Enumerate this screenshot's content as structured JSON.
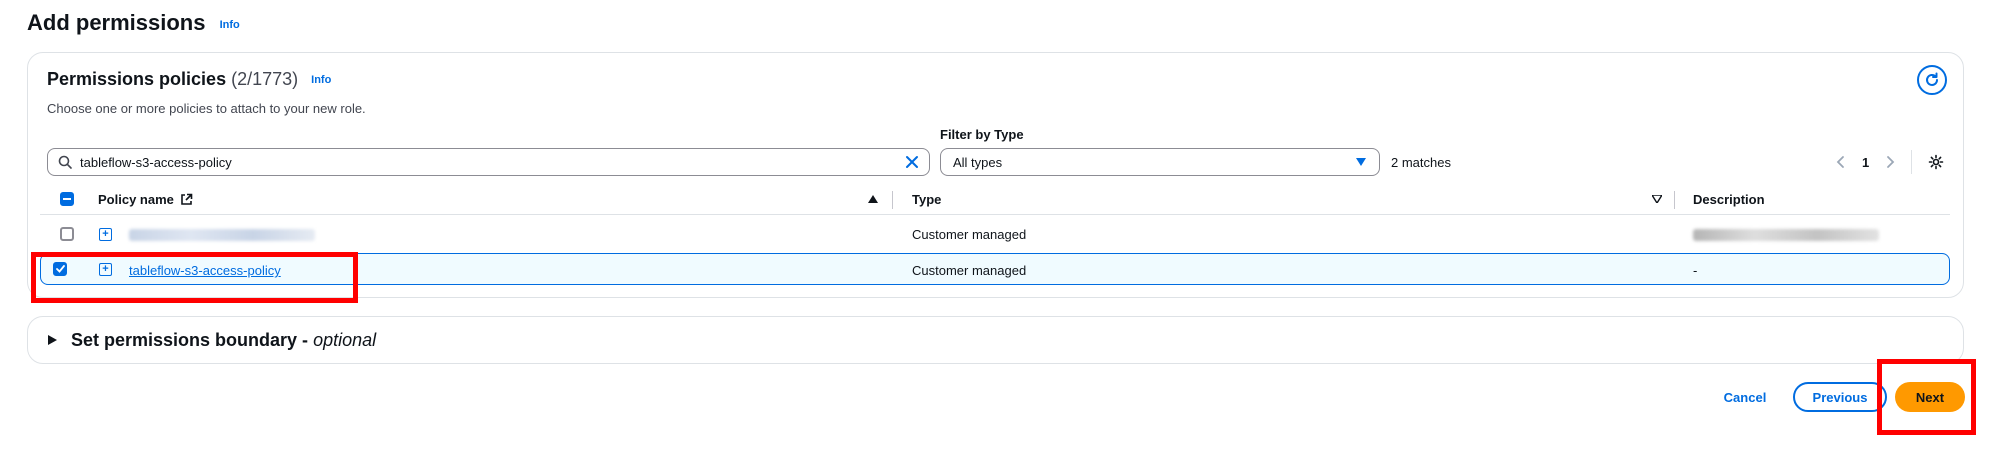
{
  "header": {
    "title": "Add permissions",
    "info": "Info"
  },
  "panel": {
    "title": "Permissions policies",
    "count": "(2/1773)",
    "info": "Info",
    "description": "Choose one or more policies to attach to your new role."
  },
  "filters": {
    "search_value": "tableflow-s3-access-policy",
    "type_label": "Filter by Type",
    "type_value": "All types",
    "matches": "2 matches",
    "page": "1"
  },
  "table": {
    "columns": {
      "name": "Policy name",
      "type": "Type",
      "description": "Description"
    },
    "rows": [
      {
        "name": "",
        "type": "Customer managed",
        "description": "",
        "checked": false
      },
      {
        "name": "tableflow-s3-access-policy",
        "type": "Customer managed",
        "description": "-",
        "checked": true
      }
    ]
  },
  "boundary": {
    "label": "Set permissions boundary - ",
    "optional": "optional"
  },
  "actions": {
    "cancel": "Cancel",
    "previous": "Previous",
    "next": "Next"
  },
  "colors": {
    "accent": "#006ce0",
    "primary_button": "#ff9900",
    "highlight": "#ff0000"
  }
}
